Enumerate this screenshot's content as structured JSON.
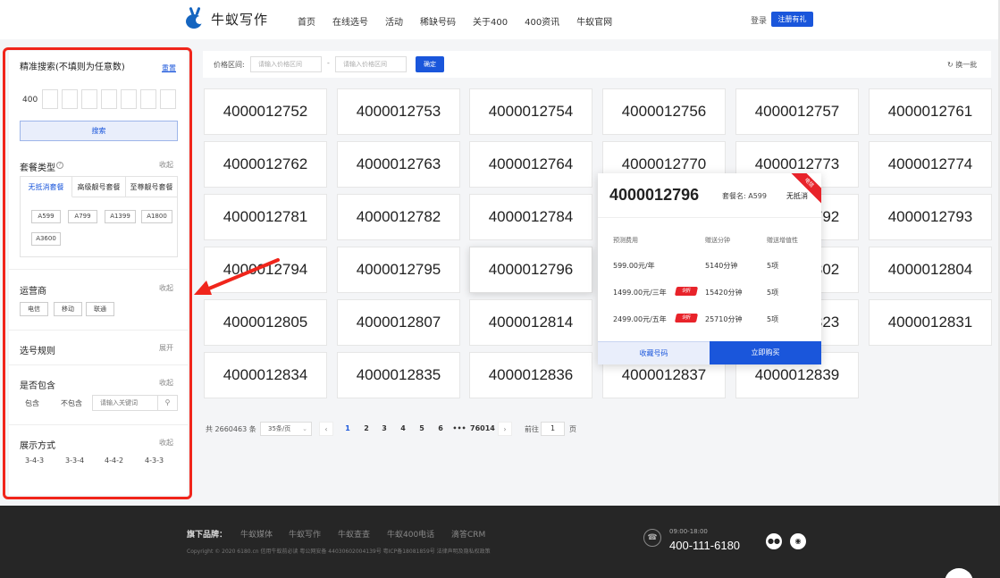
{
  "header": {
    "logo_text": "牛蚁写作",
    "nav": [
      "首页",
      "在线选号",
      "活动",
      "稀缺号码",
      "关于400",
      "400资讯",
      "牛蚁官网"
    ],
    "login_label": "登录",
    "register_label": "注册有礼"
  },
  "sidebar": {
    "precise_search": {
      "title": "精准搜索(不填则为任意数)",
      "reset_label": "重置",
      "prefix": "400",
      "search_button": "搜索"
    },
    "package_type": {
      "title": "套餐类型",
      "toggle": "收起",
      "tabs": [
        "无抵消套餐",
        "高级靓号套餐",
        "至尊靓号套餐"
      ],
      "chips": [
        "A599",
        "A799",
        "A1399",
        "A1800",
        "A3600"
      ]
    },
    "operator": {
      "title": "运营商",
      "toggle": "收起",
      "options": [
        "电信",
        "移动",
        "联通"
      ]
    },
    "rule": {
      "title": "选号规则",
      "toggle": "展开"
    },
    "contains": {
      "title": "是否包含",
      "toggle": "收起",
      "options": [
        "包含",
        "不包含"
      ],
      "placeholder": "请输入关键词"
    },
    "display": {
      "title": "展示方式",
      "toggle": "收起",
      "options": [
        "3-4-3",
        "3-3-4",
        "4-4-2",
        "4-3-3"
      ]
    }
  },
  "filter_bar": {
    "label": "价格区间:",
    "min_placeholder": "请输入价格区间",
    "max_placeholder": "请输入价格区间",
    "separator": "-",
    "confirm_label": "确定",
    "refresh_label": "换一批"
  },
  "numbers": [
    "4000012752",
    "4000012753",
    "4000012754",
    "4000012756",
    "4000012757",
    "4000012761",
    "4000012762",
    "4000012763",
    "4000012764",
    "4000012770",
    "4000012773",
    "4000012774",
    "4000012781",
    "4000012782",
    "4000012784",
    "4000012792",
    "4000012793",
    "4000012794",
    "4000012795",
    "4000012796",
    "4000012802",
    "4000012804",
    "4000012805",
    "4000012807",
    "4000012814",
    "4000012823",
    "4000012831",
    "4000012834",
    "4000012835",
    "4000012836",
    "4000012837",
    "4000012839"
  ],
  "popup": {
    "number": "4000012796",
    "package_label": "套餐名: A599",
    "type_label": "无抵消",
    "ribbon": "电信",
    "headers": [
      "预测费用",
      "赠送分钟",
      "赠送增值性"
    ],
    "rows": [
      {
        "fee": "599.00元/年",
        "minutes": "5140分钟",
        "extras": "5项",
        "badge": ""
      },
      {
        "fee": "1499.00元/三年",
        "minutes": "15420分钟",
        "extras": "5项",
        "badge": "9折"
      },
      {
        "fee": "2499.00元/五年",
        "minutes": "25710分钟",
        "extras": "5项",
        "badge": "9折"
      }
    ],
    "collect_label": "收藏号码",
    "buy_label": "立即购买"
  },
  "pagination": {
    "total": "共 2660463 条",
    "page_size": "35条/页",
    "pages": [
      "1",
      "2",
      "3",
      "4",
      "5",
      "6",
      "•••",
      "76014"
    ],
    "goto_label": "前往",
    "goto_value": "1",
    "page_suffix": "页"
  },
  "footer": {
    "brands_label": "旗下品牌：",
    "brands": [
      "牛蚁媒体",
      "牛蚁写作",
      "牛蚁查查",
      "牛蚁400电话",
      "滴答CRM"
    ],
    "copyright": "Copyright © 2020 6180.cn 信用牛蚁前必读 粤公网安备 44030602004139号 粤ICP备18081859号 法律声明及隐私权政策",
    "hours": "09:00-18:00",
    "phone": "400-111-6180"
  }
}
